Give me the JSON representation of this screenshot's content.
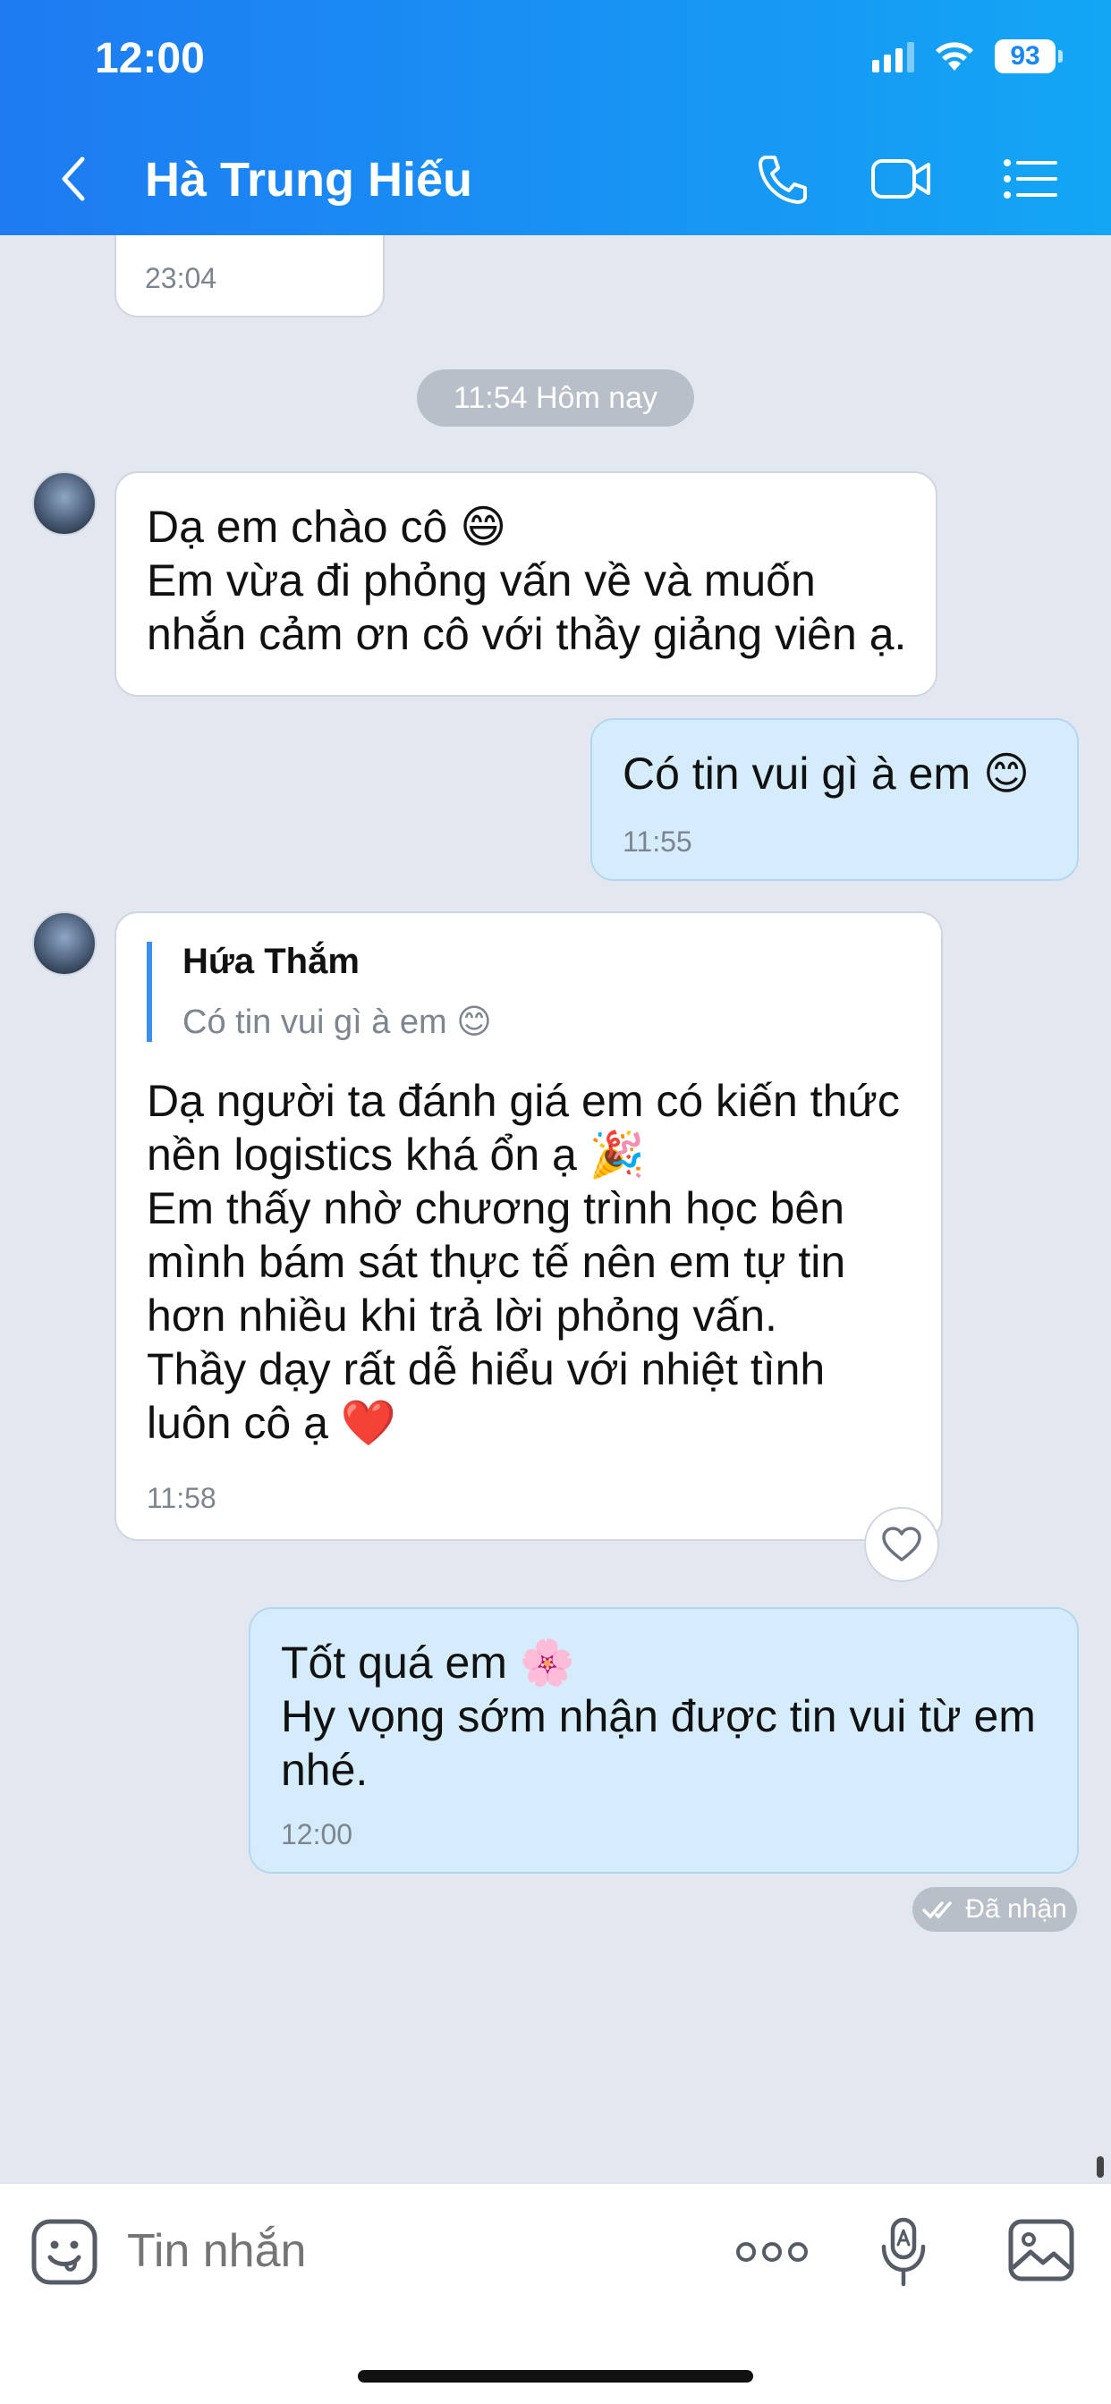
{
  "status_bar": {
    "time": "12:00",
    "battery": "93"
  },
  "header": {
    "contact_name": "Hà Trung Hiếu"
  },
  "chat": {
    "prev_message_time": "23:04",
    "date_separator": "11:54 Hôm nay",
    "messages": [
      {
        "direction": "in",
        "text": "Dạ em chào cô 😄\nEm vừa đi phỏng vấn về và muốn\nnhắn cảm ơn cô với thầy giảng viên ạ."
      },
      {
        "direction": "out",
        "text": "Có tin vui gì à em 😊",
        "time": "11:55"
      },
      {
        "direction": "in",
        "quote": {
          "name": "Hứa Thắm",
          "text": "Có tin vui gì à em 😊"
        },
        "text": "Dạ người ta đánh giá em có kiến thức\nnền logistics khá ổn ạ 🎉\nEm thấy nhờ chương trình học bên\nmình bám sát thực tế nên em tự tin\nhơn nhiều khi trả lời phỏng vấn.\nThầy dạy rất dễ hiểu với nhiệt tình\nluôn cô ạ ❤️",
        "time": "11:58"
      },
      {
        "direction": "out",
        "text": "Tốt quá em 🌸\nHy vọng sớm nhận được tin vui từ em\nnhé.",
        "time": "12:00"
      }
    ],
    "delivery_status": "Đã nhận"
  },
  "input_bar": {
    "placeholder": "Tin nhắn"
  },
  "colors": {
    "header_start": "#1e7bf2",
    "header_end": "#13a6f5",
    "outgoing_bubble": "#d5ecfc",
    "chat_bg": "#e3e8f0"
  },
  "icons": [
    "back-icon",
    "phone-icon",
    "video-call-icon",
    "menu-list-icon",
    "sticker-icon",
    "more-icon",
    "voice-icon",
    "image-icon",
    "heart-icon",
    "double-check-icon"
  ]
}
